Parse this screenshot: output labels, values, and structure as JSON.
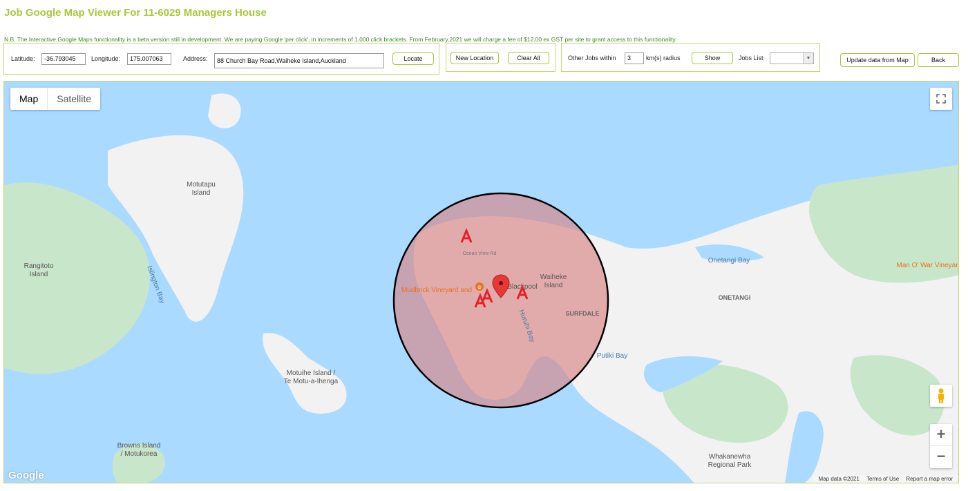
{
  "page": {
    "title": "Job Google Map Viewer For 11-6029 Managers House",
    "notice": "N.B. The Interactive Google Maps functionality is a beta version still in development. We are paying Google 'per click', in increments of 1,000 click brackets. From February,2021 we will charge a fee of $12.00 ex GST per site to grant access to this functionality."
  },
  "location_form": {
    "latitude_label": "Latitude:",
    "latitude_value": "-36.793045",
    "longitude_label": "Longitude:",
    "longitude_value": "175.007063",
    "address_label": "Address:",
    "address_value": "88 Church Bay Road,Waiheke Island,Auckland",
    "locate_label": "Locate"
  },
  "location_actions": {
    "new_location_label": "New Location",
    "clear_all_label": "Clear All"
  },
  "jobs_filter": {
    "other_jobs_label": "Other Jobs within",
    "radius_value": "3",
    "radius_unit_label": "km(s) radius",
    "show_label": "Show",
    "jobs_list_label": "Jobs List",
    "jobs_list_value": ""
  },
  "toolbar": {
    "update_label": "Update data from Map",
    "back_label": "Back"
  },
  "map": {
    "type_map_label": "Map",
    "type_satellite_label": "Satellite",
    "google_logo": "Google",
    "attribution": {
      "map_data": "Map data ©2021",
      "terms": "Terms of Use",
      "report": "Report a map error"
    },
    "place_labels": {
      "motutapu": [
        "Motutapu",
        "Island"
      ],
      "rangitoto": [
        "Rangitoto",
        "Island"
      ],
      "motuihe": [
        "Motuihe Island /",
        "Te Motu-a-Ihenga"
      ],
      "browns": [
        "Browns Island",
        "/ Motukorea"
      ],
      "waiheke": [
        "Waiheke",
        "Island"
      ],
      "blackpool": "Blackpool",
      "mudbrick": "Mudbrick Vineyard and",
      "surfdale": "SURFDALE",
      "onetangi": "ONETANGI",
      "onetangi_bay": "Onetangi Bay",
      "whakanewha": [
        "Whakanewha",
        "Regional Park"
      ],
      "man_o_war": "Man O' War Vineyar",
      "putiki_bay": "Putiki Bay",
      "huruhi_bay": "Huruhi Bay",
      "islington_bay": "Islington Bay",
      "oneroa_bay": "Ocean View Rd"
    },
    "colors": {
      "water": "#aadaff",
      "land": "#f2f2f2",
      "park": "#c8e6c9",
      "radius_fill": "#d98080",
      "radius_stroke": "#000000",
      "job_marker": "#e8202a",
      "pin": "#e53935",
      "label_orange": "#e8711a"
    },
    "icons": [
      "fullscreen-icon",
      "pegman-icon",
      "zoom-in-icon",
      "zoom-out-icon",
      "location-pin-icon",
      "job-marker-icon",
      "restaurant-icon"
    ]
  }
}
